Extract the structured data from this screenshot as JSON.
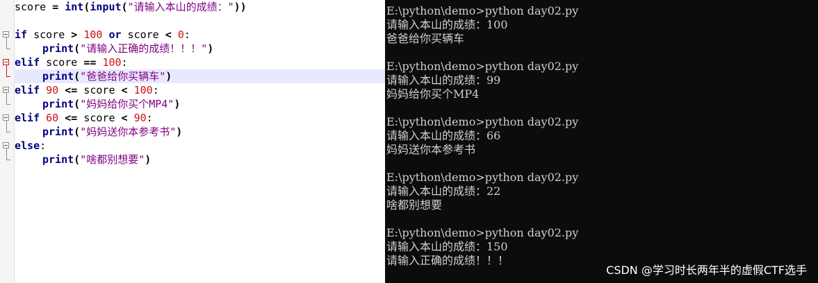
{
  "editor": {
    "lines": [
      {
        "parts": [
          [
            "pl",
            "score "
          ],
          [
            "op",
            "= "
          ],
          [
            "kw",
            "int"
          ],
          [
            "op",
            "("
          ],
          [
            "kw",
            "input"
          ],
          [
            "op",
            "("
          ],
          [
            "str",
            "\"请输入本山的成绩：\""
          ],
          [
            "op",
            "))"
          ]
        ]
      },
      {
        "parts": []
      },
      {
        "parts": [
          [
            "kw",
            "if"
          ],
          [
            "pl",
            " score "
          ],
          [
            "op",
            ">"
          ],
          [
            "pl",
            " "
          ],
          [
            "num",
            "100"
          ],
          [
            "pl",
            " "
          ],
          [
            "kw",
            "or"
          ],
          [
            "pl",
            " score "
          ],
          [
            "op",
            "<"
          ],
          [
            "pl",
            " "
          ],
          [
            "num",
            "0"
          ],
          [
            "pl",
            ":"
          ]
        ]
      },
      {
        "indent": true,
        "parts": [
          [
            "kw",
            "print"
          ],
          [
            "op",
            "("
          ],
          [
            "str",
            "\"请输入正确的成绩！！！\""
          ],
          [
            "op",
            ")"
          ]
        ]
      },
      {
        "parts": [
          [
            "kw",
            "elif"
          ],
          [
            "pl",
            " score "
          ],
          [
            "op",
            "=="
          ],
          [
            "pl",
            " "
          ],
          [
            "num",
            "100"
          ],
          [
            "pl",
            ":"
          ]
        ]
      },
      {
        "indent": true,
        "parts": [
          [
            "kw",
            "print"
          ],
          [
            "op",
            "("
          ],
          [
            "str",
            "\"爸爸给你买辆车\""
          ],
          [
            "op",
            ")"
          ]
        ]
      },
      {
        "parts": [
          [
            "kw",
            "elif"
          ],
          [
            "pl",
            " "
          ],
          [
            "num",
            "90"
          ],
          [
            "pl",
            " "
          ],
          [
            "op",
            "<="
          ],
          [
            "pl",
            " score "
          ],
          [
            "op",
            "<"
          ],
          [
            "pl",
            " "
          ],
          [
            "num",
            "100"
          ],
          [
            "pl",
            ":"
          ]
        ]
      },
      {
        "indent": true,
        "parts": [
          [
            "kw",
            "print"
          ],
          [
            "op",
            "("
          ],
          [
            "str",
            "\"妈妈给你买个MP4\""
          ],
          [
            "op",
            ")"
          ]
        ]
      },
      {
        "parts": [
          [
            "kw",
            "elif"
          ],
          [
            "pl",
            " "
          ],
          [
            "num",
            "60"
          ],
          [
            "pl",
            " "
          ],
          [
            "op",
            "<="
          ],
          [
            "pl",
            " score "
          ],
          [
            "op",
            "<"
          ],
          [
            "pl",
            " "
          ],
          [
            "num",
            "90"
          ],
          [
            "pl",
            ":"
          ]
        ]
      },
      {
        "indent": true,
        "parts": [
          [
            "kw",
            "print"
          ],
          [
            "op",
            "("
          ],
          [
            "str",
            "\"妈妈送你本参考书\""
          ],
          [
            "op",
            ")"
          ]
        ]
      },
      {
        "parts": [
          [
            "kw",
            "else"
          ],
          [
            "pl",
            ":"
          ]
        ]
      },
      {
        "indent": true,
        "parts": [
          [
            "kw",
            "print"
          ],
          [
            "op",
            "("
          ],
          [
            "str",
            "\"啥都别想要\""
          ],
          [
            "op",
            ")"
          ]
        ]
      }
    ]
  },
  "console": {
    "lines": [
      "E:\\python\\demo>python day02.py",
      "请输入本山的成绩：100",
      "爸爸给你买辆车",
      "",
      "E:\\python\\demo>python day02.py",
      "请输入本山的成绩：99",
      "妈妈给你买个MP4",
      "",
      "E:\\python\\demo>python day02.py",
      "请输入本山的成绩：66",
      "妈妈送你本参考书",
      "",
      "E:\\python\\demo>python day02.py",
      "请输入本山的成绩：22",
      "啥都别想要",
      "",
      "E:\\python\\demo>python day02.py",
      "请输入本山的成绩：150",
      "请输入正确的成绩！！！"
    ]
  },
  "watermark": "CSDN @学习时长两年半的虚假CTF选手",
  "colors": {
    "keyword": "#00007f",
    "string": "#7f007f",
    "number": "#d01010",
    "current_line": "#e8e8ff",
    "console_bg": "#0c0c0c",
    "console_text": "#d0d0d0"
  }
}
